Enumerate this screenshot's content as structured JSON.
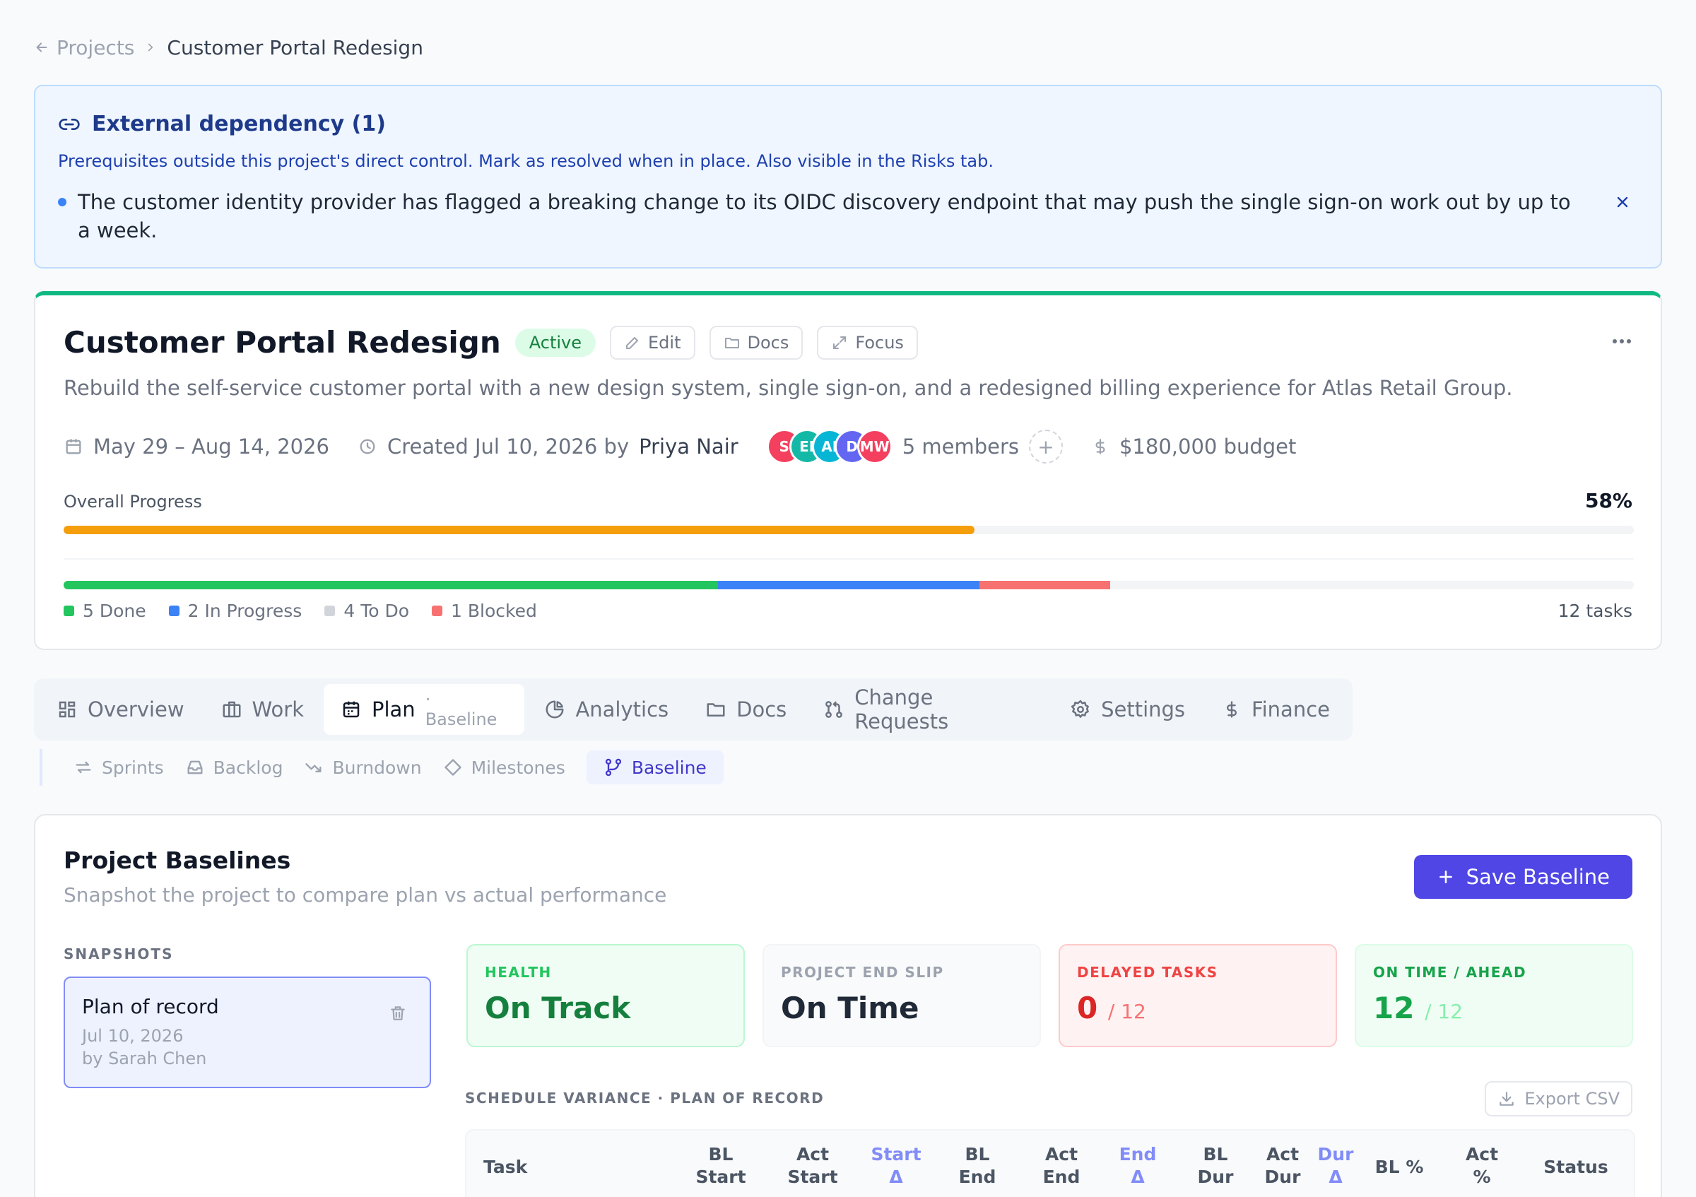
{
  "breadcrumb": {
    "parent": "Projects",
    "current": "Customer Portal Redesign"
  },
  "alert": {
    "title": "External dependency (1)",
    "description": "Prerequisites outside this project's direct control. Mark as resolved when in place. Also visible in the Risks tab.",
    "item": "The customer identity provider has flagged a breaking change to its OIDC discovery endpoint that may push the single sign-on work out by up to a week."
  },
  "project": {
    "title": "Customer Portal Redesign",
    "status": "Active",
    "actions": {
      "edit": "Edit",
      "docs": "Docs",
      "focus": "Focus"
    },
    "description": "Rebuild the self-service customer portal with a new design system, single sign-on, and a redesigned billing experience for Atlas Retail Group.",
    "date_range": "May 29 – Aug 14, 2026",
    "created": "Created Jul 10, 2026 by",
    "created_by": "Priya Nair",
    "members": [
      {
        "initials": "S",
        "color": "#f43f5e"
      },
      {
        "initials": "EI",
        "color": "#14b8a6"
      },
      {
        "initials": "AI",
        "color": "#06b6d4"
      },
      {
        "initials": "D",
        "color": "#6366f1"
      },
      {
        "initials": "MW",
        "color": "#f43f5e"
      }
    ],
    "members_label": "5 members",
    "budget": "$180,000 budget",
    "progress_label": "Overall Progress",
    "progress_pct": "58%",
    "progress_value": 58,
    "task_breakdown": [
      {
        "label": "5 Done",
        "count": 5,
        "color": "#22c55e"
      },
      {
        "label": "2 In Progress",
        "count": 2,
        "color": "#3b82f6"
      },
      {
        "label": "4 To Do",
        "count": 4,
        "color": "#d1d5db"
      },
      {
        "label": "1 Blocked",
        "count": 1,
        "color": "#f87171"
      }
    ],
    "task_total": "12 tasks"
  },
  "tabs": {
    "overview": "Overview",
    "work": "Work",
    "plan": "Plan",
    "plan_sub": "· Baseline",
    "analytics": "Analytics",
    "docs": "Docs",
    "change_requests": "Change Requests",
    "settings": "Settings",
    "finance": "Finance"
  },
  "subtabs": {
    "sprints": "Sprints",
    "backlog": "Backlog",
    "burndown": "Burndown",
    "milestones": "Milestones",
    "baseline": "Baseline"
  },
  "baselines": {
    "title": "Project Baselines",
    "subtitle": "Snapshot the project to compare plan vs actual performance",
    "save_label": "Save Baseline",
    "snapshots_label": "SNAPSHOTS",
    "snapshot": {
      "name": "Plan of record",
      "date": "Jul 10, 2026",
      "by": "by Sarah Chen"
    },
    "stats": {
      "health_label": "HEALTH",
      "health_value": "On Track",
      "slip_label": "PROJECT END SLIP",
      "slip_value": "On Time",
      "delayed_label": "DELAYED TASKS",
      "delayed_value": "0",
      "delayed_total": "/ 12",
      "ontime_label": "ON TIME / AHEAD",
      "ontime_value": "12",
      "ontime_total": "/ 12"
    },
    "variance_label": "SCHEDULE VARIANCE · PLAN OF RECORD",
    "export_label": "Export CSV",
    "columns": {
      "task": "Task",
      "bl_start_1": "BL",
      "bl_start_2": "Start",
      "act_start_1": "Act",
      "act_start_2": "Start",
      "start_d_1": "Start",
      "start_d_2": "Δ",
      "bl_end_1": "BL",
      "bl_end_2": "End",
      "act_end_1": "Act",
      "act_end_2": "End",
      "end_d_1": "End",
      "end_d_2": "Δ",
      "bl_dur_1": "BL",
      "bl_dur_2": "Dur",
      "act_dur_1": "Act",
      "act_dur_2": "Dur",
      "dur_d_1": "Dur",
      "dur_d_2": "Δ",
      "bl_pct": "BL %",
      "act_pct_1": "Act",
      "act_pct_2": "%",
      "status": "Status"
    }
  }
}
